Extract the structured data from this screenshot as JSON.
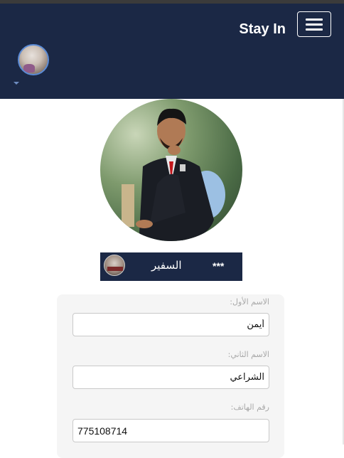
{
  "navbar": {
    "brand": "Stay In",
    "menu_icon": "hamburger-icon",
    "avatar_icon": "user-avatar",
    "caret_icon": "caret-down-icon",
    "background": "#1b2845"
  },
  "profile": {
    "photo": "profile-photo",
    "strip": {
      "name": "السفير",
      "stars": "***",
      "avatar": "strip-avatar"
    }
  },
  "form": {
    "first_name": {
      "label": "الاسم الأول:",
      "value": "أيمن"
    },
    "second_name": {
      "label": "الاسم الثاني:",
      "value": "الشراعي"
    },
    "phone": {
      "label": "رقم الهاتف:",
      "value": "775108714"
    }
  }
}
